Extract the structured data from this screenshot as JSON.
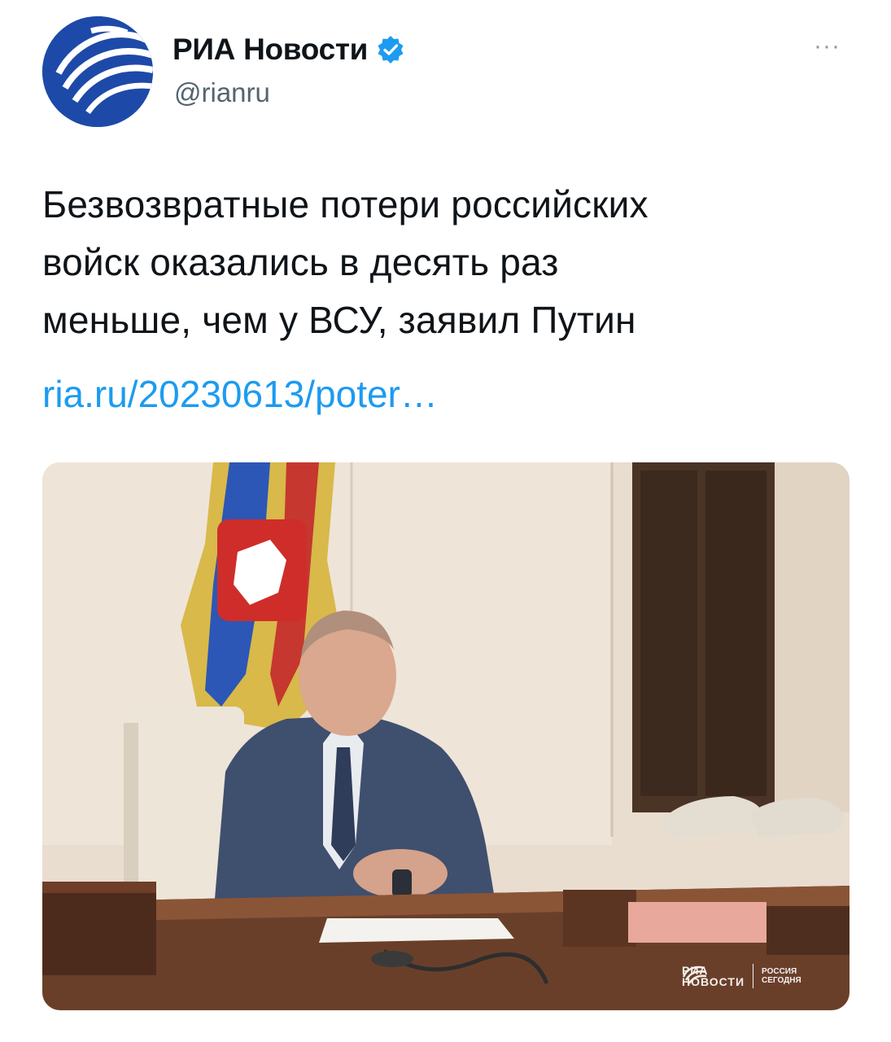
{
  "account": {
    "display_name": "РИА Новости",
    "handle": "@rianru",
    "verified": true,
    "avatar_icon": "ria-novosti-logo-icon",
    "brand_color": "#1d4aa8",
    "verified_color": "#1d9bf0"
  },
  "menu": {
    "more_label": "···"
  },
  "tweet": {
    "text": "Безвозвратные потери российских\nвойск оказались в десять раз\nменьше, чем у ВСУ, заявил Путин",
    "link_text": "ria.ru/20230613/poter…",
    "link_color": "#1d9bf0"
  },
  "media": {
    "watermark": {
      "brand": "РИА\nНОВОСТИ",
      "partner": "РОССИЯ\nСЕГОДНЯ"
    }
  }
}
